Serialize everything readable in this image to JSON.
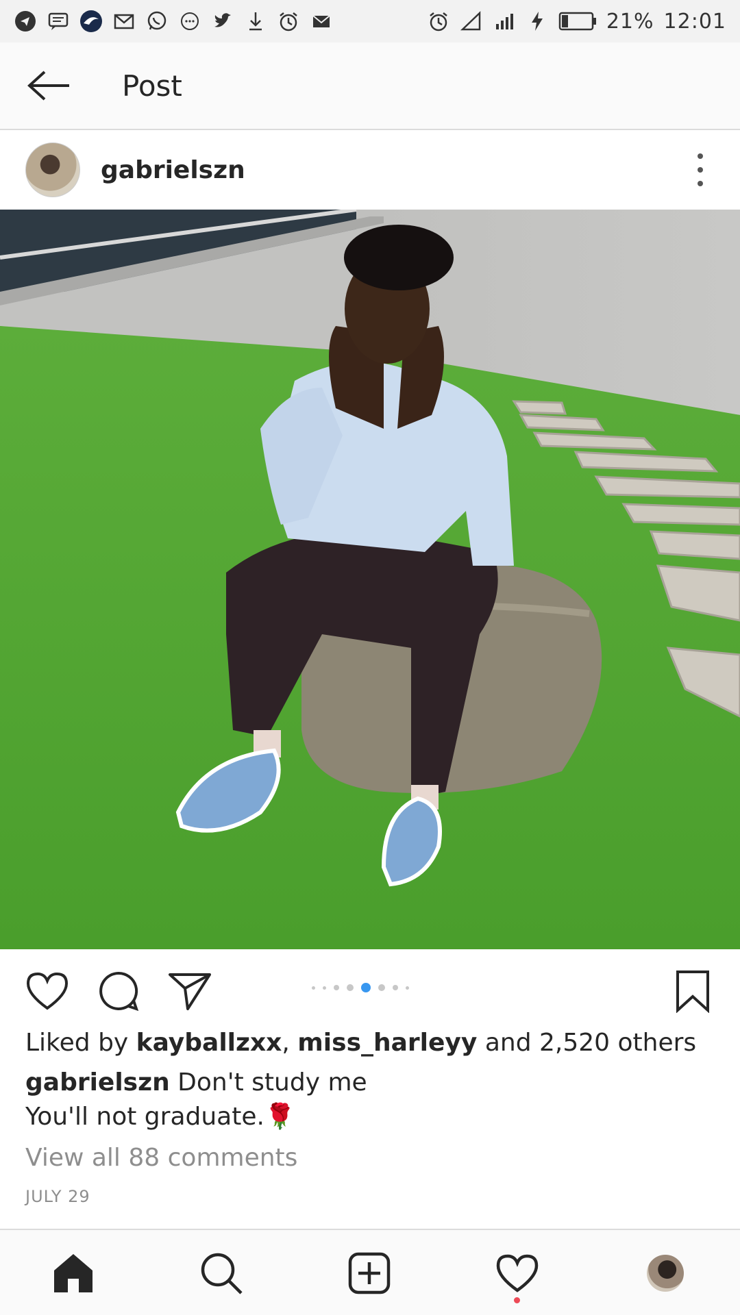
{
  "status_bar": {
    "left_icons": [
      "telegram-icon",
      "message-icon",
      "app-icon",
      "gmail-icon",
      "whatsapp-icon",
      "chat-icon",
      "twitter-icon",
      "download-icon",
      "alarm-icon",
      "mail-icon"
    ],
    "right_icons": [
      "alarm-icon",
      "signal-icon",
      "network-icon",
      "charging-icon",
      "battery-icon"
    ],
    "battery": "21%",
    "time": "12:01"
  },
  "app_bar": {
    "title": "Post"
  },
  "post": {
    "username": "gabrielszn",
    "carousel": {
      "count": 8,
      "active": 5
    },
    "likes": {
      "prefix": "Liked by ",
      "user1": "kayballzxx",
      "sep": ", ",
      "user2": "miss_harleyy",
      "suffix": " and 2,520 others"
    },
    "caption": {
      "user": "gabrielszn",
      "line1": " Don't study me",
      "line2": "You'll not graduate.🌹"
    },
    "comments_link": "View all 88 comments",
    "date": "JULY 29"
  },
  "bottom_nav": [
    "home-icon",
    "search-icon",
    "add-post-icon",
    "activity-icon",
    "profile-avatar"
  ],
  "colors": {
    "text": "#262626",
    "muted": "#8e8e8e",
    "accent": "#3897f0",
    "notification": "#ed4956"
  }
}
